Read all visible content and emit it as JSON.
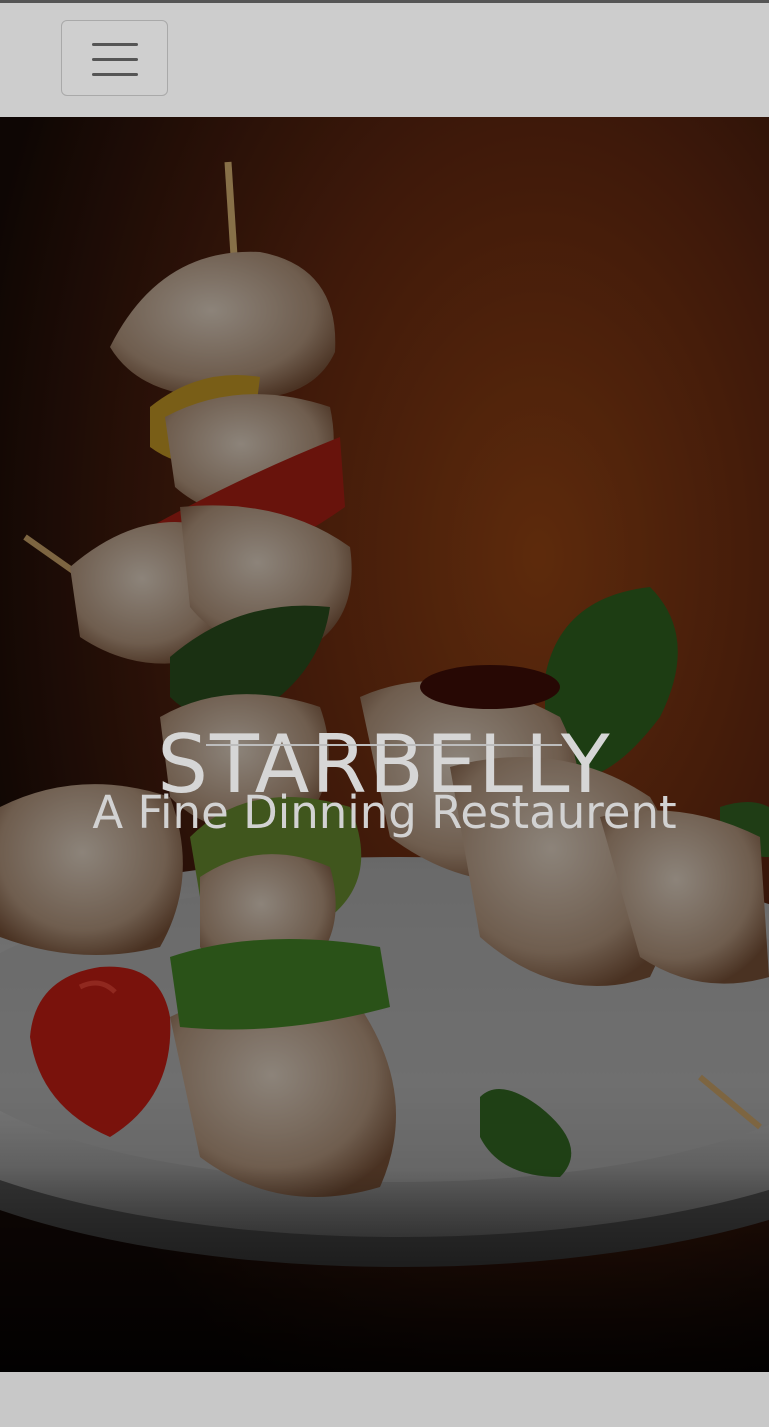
{
  "navbar": {
    "menu_icon": "hamburger-menu-icon"
  },
  "hero": {
    "title": "STARBELLY",
    "subtitle": "A Fine Dinning Restaurent",
    "image": "chicken-kebab-skewer-photo"
  },
  "colors": {
    "navbar_bg": "#cdcdcd",
    "hero_text": "#d6d6d6",
    "hero_bg_warm": "#6b2f10"
  }
}
